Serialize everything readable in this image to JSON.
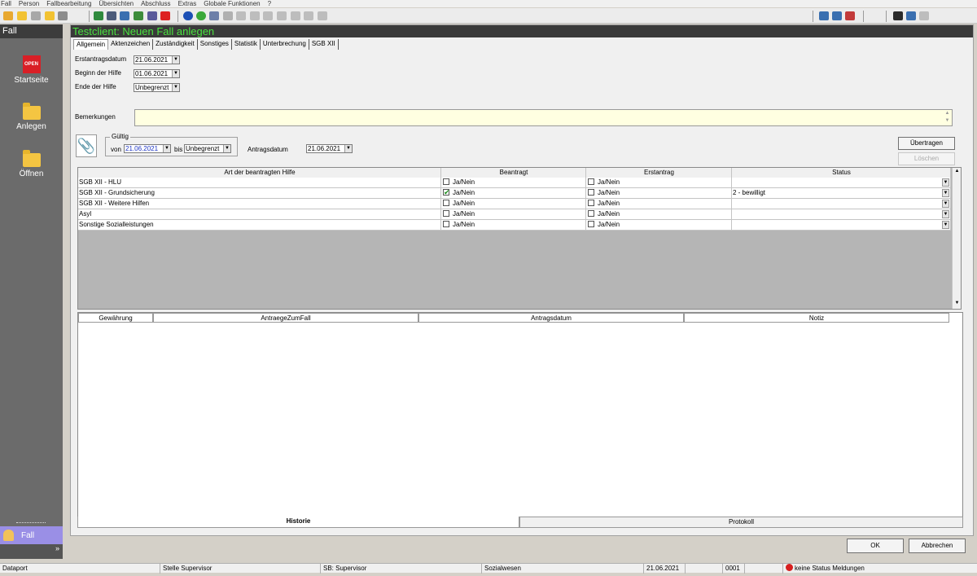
{
  "menu": [
    "Fall",
    "Person",
    "Fallbearbeitung",
    "Übersichten",
    "Abschluss",
    "Extras",
    "Globale Funktionen",
    "?"
  ],
  "nav": {
    "header": "Fall",
    "start": "Startseite",
    "start_logo": "OPEN",
    "create": "Anlegen",
    "open": "Öffnen",
    "bottom_item": "Fall",
    "more": "»"
  },
  "window": {
    "title": "Testclient: Neuen Fall anlegen"
  },
  "tabs": [
    "Allgemein",
    "Aktenzeichen",
    "Zuständigkeit",
    "Sonstiges",
    "Statistik",
    "Unterbrechung",
    "SGB XII"
  ],
  "form": {
    "erstantrag_label": "Erstantragsdatum",
    "erstantrag_value": "21.06.2021",
    "beginn_label": "Beginn der Hilfe",
    "beginn_value": "01.06.2021",
    "ende_label": "Ende der Hilfe",
    "ende_value": "Unbegrenzt",
    "bemerkungen_label": "Bemerkungen",
    "bemerkungen_value": "",
    "gueltig_label": "Gültig",
    "von_label": "von",
    "von_value": "21.06.2021",
    "bis_label": "bis",
    "bis_value": "Unbegrenzt",
    "antragsdatum_label": "Antragsdatum",
    "antragsdatum_value": "21.06.2021"
  },
  "buttons": {
    "uebertragen": "Übertragen",
    "loeschen": "Löschen",
    "ok": "OK",
    "abbrechen": "Abbrechen"
  },
  "grid1": {
    "headers": [
      "Art der beantragten Hilfe",
      "Beantragt",
      "Erstantrag",
      "Status"
    ],
    "rows": [
      {
        "art": "SGB XII - HLU",
        "beantragt_text": "Ja/Nein",
        "beantragt": false,
        "erstantrag_text": "Ja/Nein",
        "erstantrag": false,
        "status": ""
      },
      {
        "art": "SGB XII - Grundsicherung",
        "beantragt_text": "Ja/Nein",
        "beantragt": true,
        "erstantrag_text": "Ja/Nein",
        "erstantrag": false,
        "status": "2 - bewilligt"
      },
      {
        "art": "SGB XII - Weitere Hilfen",
        "beantragt_text": "Ja/Nein",
        "beantragt": false,
        "erstantrag_text": "Ja/Nein",
        "erstantrag": false,
        "status": ""
      },
      {
        "art": "Asyl",
        "beantragt_text": "Ja/Nein",
        "beantragt": false,
        "erstantrag_text": "Ja/Nein",
        "erstantrag": false,
        "status": ""
      },
      {
        "art": "Sonstige Sozialleistungen",
        "beantragt_text": "Ja/Nein",
        "beantragt": false,
        "erstantrag_text": "Ja/Nein",
        "erstantrag": false,
        "status": ""
      }
    ]
  },
  "grid2": {
    "headers": [
      "Gewährung",
      "AntraegeZumFall",
      "Antragsdatum",
      "Notiz"
    ]
  },
  "bottom_tabs": [
    "Historie",
    "Protokoll"
  ],
  "statusbar": [
    "Dataport",
    "Stelle Supervisor",
    "SB: Supervisor",
    "Sozialwesen",
    "21.06.2021",
    "",
    "0001",
    "",
    "keine Status Meldungen"
  ],
  "colors": {
    "title_fg": "#49e23f",
    "title_bg": "#3a3a3a",
    "nav_bg": "#6b6b6b",
    "nav_active": "#9a8fe6",
    "bemerk_bg": "#ffffe1"
  }
}
